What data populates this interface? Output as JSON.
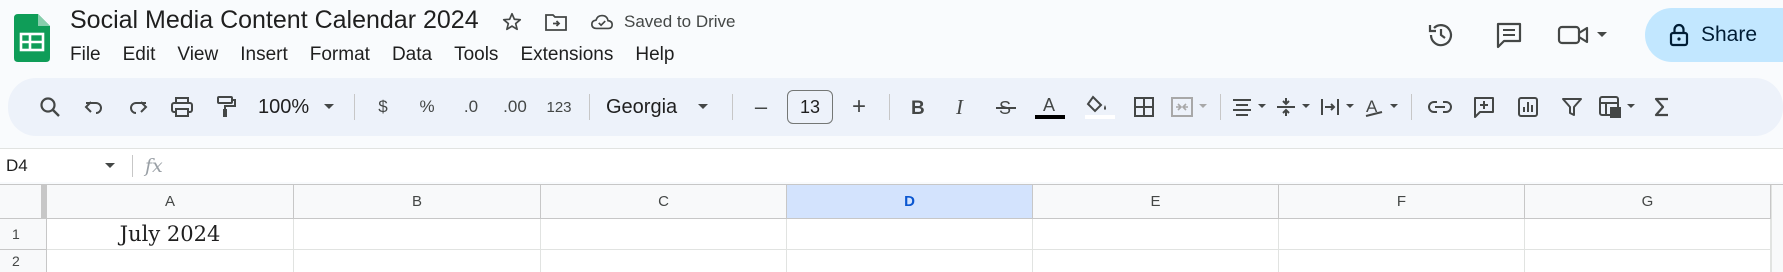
{
  "document": {
    "title": "Social Media Content Calendar 2024",
    "save_status": "Saved to Drive"
  },
  "menu": [
    "File",
    "Edit",
    "View",
    "Insert",
    "Format",
    "Data",
    "Tools",
    "Extensions",
    "Help"
  ],
  "header_actions": {
    "share_label": "Share"
  },
  "toolbar": {
    "zoom": "100%",
    "currency": "$",
    "percent": "%",
    "decrease_decimal": ".0",
    "increase_decimal": ".00",
    "number_format": "123",
    "font": "Georgia",
    "font_size": "13",
    "minus": "–",
    "plus": "+"
  },
  "formula_bar": {
    "cell_ref": "D4",
    "fx": "fx",
    "value": ""
  },
  "grid": {
    "columns": [
      "A",
      "B",
      "C",
      "D",
      "E",
      "F",
      "G"
    ],
    "selected_column": "D",
    "rows": [
      "1",
      "2"
    ],
    "cells": {
      "A1": "July 2024"
    }
  },
  "colors": {
    "brand_green": "#0f9d58",
    "share_bg": "#c2e7ff",
    "selected_header": "#d3e3fd",
    "toolbar_bg": "#edf2fa"
  }
}
